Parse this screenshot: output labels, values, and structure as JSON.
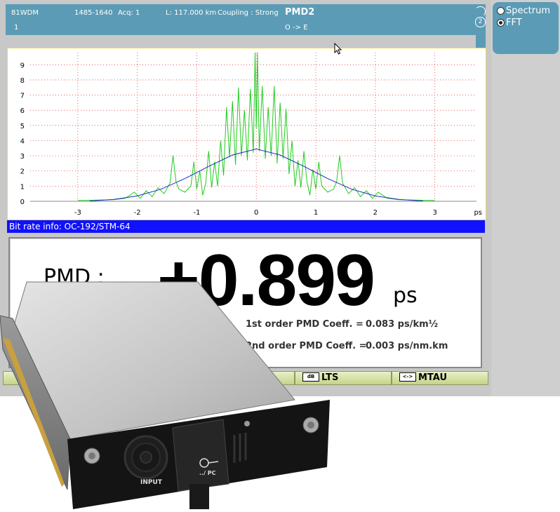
{
  "header": {
    "line1": [
      "81WDM",
      "1485-1640",
      "Acq: 1",
      "L: 117.000 km",
      "Coupling : Strong"
    ],
    "trace_index": "1",
    "title": "PMD2",
    "direction": "O -> E",
    "side_number": "2"
  },
  "mode": {
    "options": [
      {
        "label": "Spectrum",
        "selected": false
      },
      {
        "label": "FFT",
        "selected": true
      }
    ]
  },
  "chart_data": {
    "type": "line",
    "title": "",
    "xlabel": "ps",
    "ylabel": "",
    "xlim": [
      -3.8,
      3.7
    ],
    "ylim": [
      0,
      9.8
    ],
    "x_ticks": [
      -3,
      -2,
      -1,
      0,
      1,
      2,
      3
    ],
    "y_ticks": [
      0,
      1,
      2,
      3,
      4,
      5,
      6,
      7,
      8,
      9
    ],
    "grid": true,
    "series": [
      {
        "name": "",
        "color": "#22cc22",
        "x": [
          -3.0,
          -2.4,
          -2.2,
          -2.05,
          -1.95,
          -1.85,
          -1.75,
          -1.65,
          -1.55,
          -1.45,
          -1.4,
          -1.35,
          -1.3,
          -1.2,
          -1.1,
          -1.05,
          -1.0,
          -0.95,
          -0.9,
          -0.85,
          -0.8,
          -0.75,
          -0.7,
          -0.65,
          -0.6,
          -0.55,
          -0.5,
          -0.45,
          -0.4,
          -0.35,
          -0.3,
          -0.25,
          -0.2,
          -0.15,
          -0.1,
          -0.05,
          -0.02,
          0.0,
          0.02,
          0.05,
          0.1,
          0.15,
          0.2,
          0.25,
          0.3,
          0.35,
          0.4,
          0.45,
          0.5,
          0.55,
          0.6,
          0.65,
          0.7,
          0.75,
          0.8,
          0.85,
          0.9,
          0.95,
          1.0,
          1.05,
          1.1,
          1.2,
          1.3,
          1.35,
          1.4,
          1.45,
          1.55,
          1.65,
          1.75,
          1.85,
          1.95,
          2.05,
          2.2,
          2.4,
          3.0
        ],
        "y": [
          0.05,
          0.1,
          0.2,
          0.6,
          0.2,
          0.7,
          0.3,
          0.9,
          0.5,
          1.2,
          3.0,
          1.3,
          0.8,
          0.6,
          1.0,
          2.6,
          0.8,
          2.0,
          0.4,
          1.2,
          3.3,
          0.9,
          2.6,
          1.0,
          4.0,
          1.7,
          6.2,
          2.9,
          6.6,
          2.4,
          7.5,
          3.0,
          6.0,
          2.7,
          7.4,
          3.2,
          9.8,
          4.8,
          9.8,
          3.3,
          7.6,
          2.8,
          6.2,
          3.0,
          7.6,
          2.5,
          6.5,
          2.8,
          6.1,
          1.8,
          4.0,
          1.0,
          2.7,
          0.9,
          3.3,
          1.3,
          0.4,
          2.1,
          0.8,
          2.6,
          1.0,
          0.6,
          0.8,
          1.3,
          3.0,
          1.2,
          0.5,
          0.9,
          0.3,
          0.7,
          0.2,
          0.6,
          0.2,
          0.1,
          0.05
        ]
      },
      {
        "name": "",
        "color": "#1a2fc0",
        "x": [
          -2.8,
          -2.4,
          -2.0,
          -1.6,
          -1.2,
          -0.8,
          -0.4,
          0.0,
          0.4,
          0.8,
          1.2,
          1.6,
          2.0,
          2.4,
          2.8
        ],
        "y": [
          0.02,
          0.12,
          0.35,
          0.8,
          1.5,
          2.3,
          3.05,
          3.45,
          3.05,
          2.3,
          1.5,
          0.8,
          0.35,
          0.12,
          0.02
        ]
      }
    ]
  },
  "bit_rate_info": "Bit rate info: OC-192/STM-64",
  "result": {
    "label": "PMD :",
    "value": "+0.899",
    "unit": "ps",
    "coef1_label": "1st order PMD Coeff. =",
    "coef1_value": "0.083 ps/km½",
    "coef2_label": "2nd order PMD Coeff. =",
    "coef2_value": "0.003 ps/nm.km"
  },
  "tabs": [
    {
      "label": "LTS",
      "icon": "dB"
    },
    {
      "label": "MTAU",
      "icon": "<->"
    }
  ],
  "module": {
    "input_label": "INPUT",
    "port_label": "../ PC"
  }
}
